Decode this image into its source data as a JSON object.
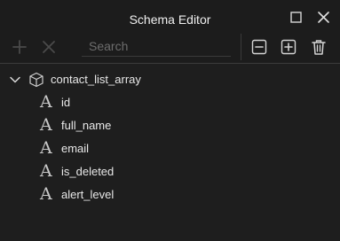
{
  "window": {
    "title": "Schema Editor",
    "maximize_icon": "square-icon",
    "close_icon": "x-icon"
  },
  "toolbar": {
    "add_icon": "plus-icon",
    "remove_icon": "x-icon",
    "search_placeholder": "Search",
    "search_value": "",
    "collapse_icon": "minus-box-icon",
    "expand_icon": "plus-box-icon",
    "delete_icon": "trash-icon"
  },
  "tree": {
    "root": {
      "label": "contact_list_array",
      "expanded": true,
      "icon": "cube-icon"
    },
    "fields": [
      {
        "label": "id",
        "icon": "font-a-icon"
      },
      {
        "label": "full_name",
        "icon": "font-a-icon"
      },
      {
        "label": "email",
        "icon": "font-a-icon"
      },
      {
        "label": "is_deleted",
        "icon": "font-a-icon"
      },
      {
        "label": "alert_level",
        "icon": "font-a-icon"
      }
    ],
    "field_type_glyph": "A"
  },
  "colors": {
    "background": "#1e1e1e",
    "text": "#e6e6e6",
    "disabled_icon": "#4a4a4a",
    "icon": "#d0d0d0"
  }
}
